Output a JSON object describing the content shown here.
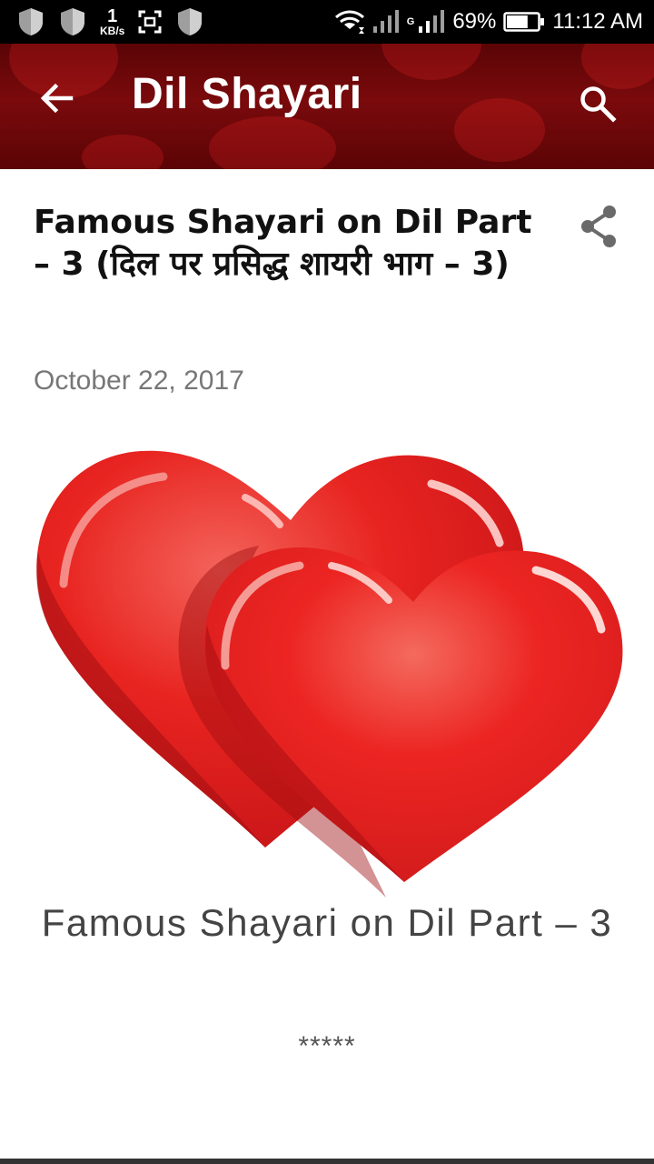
{
  "status_bar": {
    "speed_value": "1",
    "speed_unit": "KB/s",
    "network_type": "G",
    "battery_percent": "69%",
    "battery_level": 0.69,
    "time": "11:12 AM"
  },
  "app_bar": {
    "title": "Dil Shayari",
    "back_icon": "arrow-back-icon",
    "search_icon": "search-icon"
  },
  "post": {
    "title": "Famous Shayari on Dil Part – 3 (दिल पर प्रसिद्ध शायरी भाग – 3)",
    "date": "October 22, 2017",
    "share_icon": "share-icon",
    "caption": "Famous Shayari on Dil Part – 3",
    "separator": "*****"
  },
  "colors": {
    "app_bar_bg": "#6b0709",
    "heart_red": "#e8201f",
    "title_text": "#111111",
    "date_text": "#777777"
  }
}
